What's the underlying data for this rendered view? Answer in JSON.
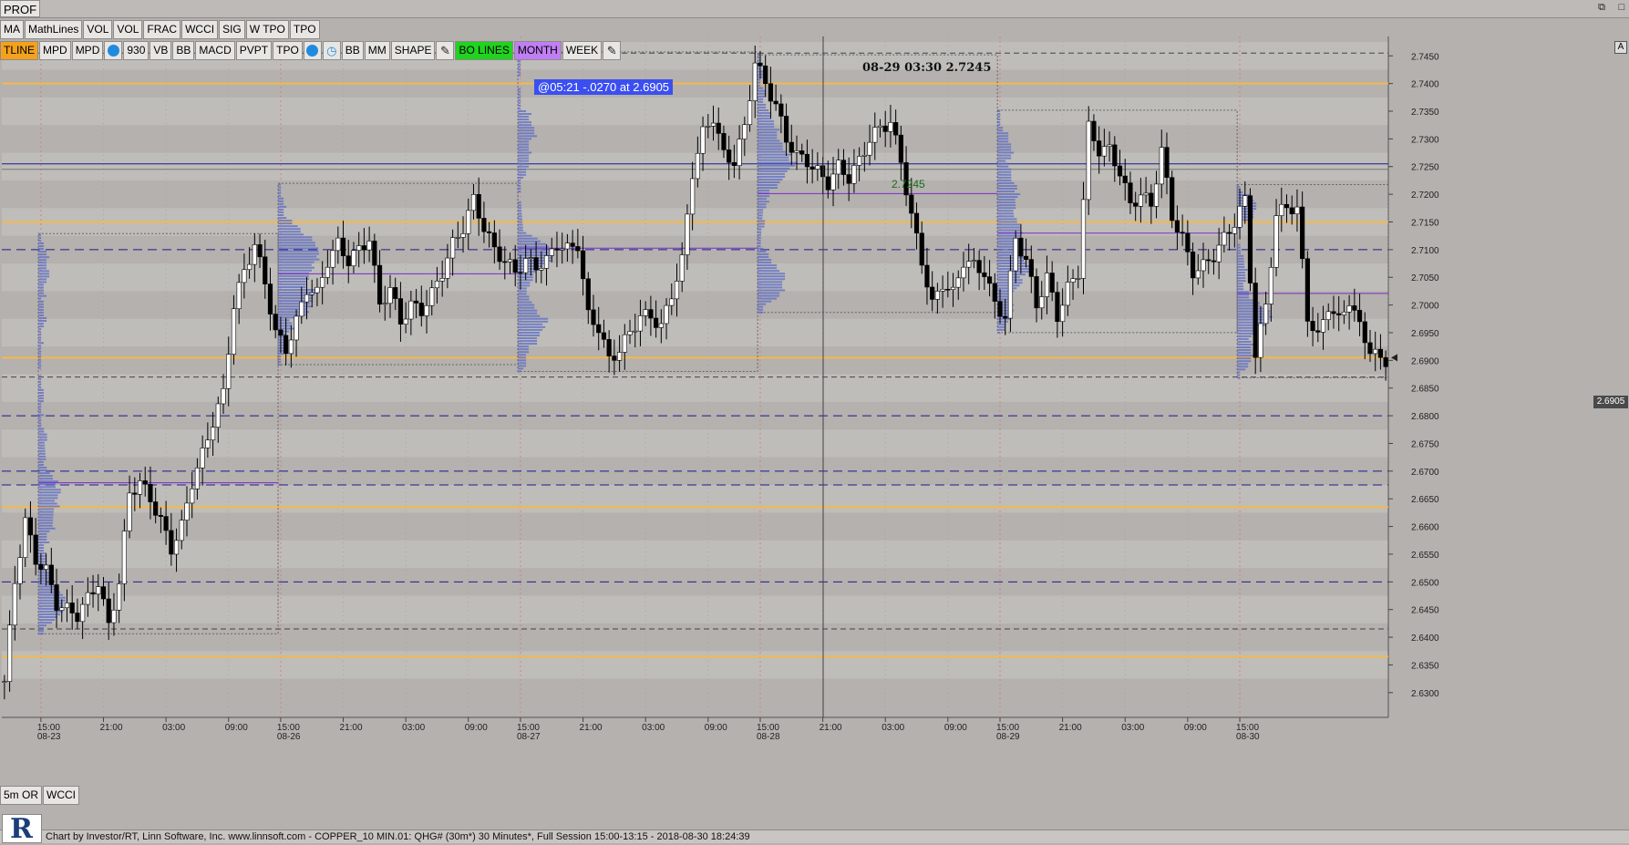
{
  "window": {
    "title": "PROF",
    "controls": [
      "restore-icon",
      "maximize-icon"
    ]
  },
  "toolbar1": [
    "MA",
    "MathLines",
    "VOL",
    "VOL",
    "FRAC",
    "WCCI",
    "SIG",
    "W TPO",
    "TPO"
  ],
  "toolbar2": [
    {
      "label": "TLINE",
      "style": "orange"
    },
    {
      "label": "MPD",
      "style": ""
    },
    {
      "label": "MPD",
      "style": ""
    },
    {
      "label": "",
      "style": "icon",
      "icon": "drop-icon"
    },
    {
      "label": "930",
      "style": ""
    },
    {
      "label": "VB",
      "style": ""
    },
    {
      "label": "BB",
      "style": ""
    },
    {
      "label": "MACD",
      "style": ""
    },
    {
      "label": "PVPT",
      "style": ""
    },
    {
      "label": "TPO",
      "style": ""
    },
    {
      "label": "",
      "style": "icon",
      "icon": "drop-icon"
    },
    {
      "label": "",
      "style": "icon",
      "icon": "clock-icon"
    },
    {
      "label": "BB",
      "style": ""
    },
    {
      "label": "MM",
      "style": ""
    },
    {
      "label": "SHAPE",
      "style": ""
    },
    {
      "label": "",
      "style": "icon",
      "icon": "pencil-icon"
    },
    {
      "label": "BO LINES",
      "style": "green"
    },
    {
      "label": "MONTH",
      "style": "purple"
    },
    {
      "label": "WEEK",
      "style": ""
    },
    {
      "label": "",
      "style": "icon",
      "icon": "pencil-icon"
    }
  ],
  "toolbar3": [
    "5m OR",
    "WCCI"
  ],
  "annotation": "@05:21  -.0270 at 2.6905",
  "crosshair_info": "08-29 03:30  2.7245",
  "poc_marker": "2.7245",
  "last_price": "2.6905",
  "corner_label": "A",
  "status": "Chart by Investor/RT, Linn Software, Inc. www.linnsoft.com - COPPER_10 MIN.01: QHG# (30m*) 30 Minutes*, Full Session 15:00-13:15 - 2018-08-30 18:24:39",
  "colors": {
    "background": "#b4b1ae",
    "band_light": "#c9c6c3",
    "bull": "#ffffff",
    "bear": "#000000",
    "profile": "#5b6cc8",
    "profile_gray": "#707070",
    "orange_line": "#f5b84a",
    "navy_line": "#1b1b8f",
    "purple_line": "#7b2cc8"
  },
  "chart_data": {
    "type": "candlestick",
    "instrument": "QHG#",
    "y_ticks": [
      "2.7450",
      "2.7400",
      "2.7350",
      "2.7300",
      "2.7250",
      "2.7200",
      "2.7150",
      "2.7100",
      "2.7050",
      "2.7000",
      "2.6950",
      "2.6900",
      "2.6850",
      "2.6800",
      "2.6750",
      "2.6700",
      "2.6650",
      "2.6600",
      "2.6550",
      "2.6500",
      "2.6450",
      "2.6400",
      "2.6350",
      "2.6300"
    ],
    "ylim": [
      2.6275,
      2.7485
    ],
    "x_ticks": [
      {
        "t": "15:00",
        "d": "08-23",
        "bar": 7
      },
      {
        "t": "21:00",
        "bar": 19
      },
      {
        "t": "03:00",
        "bar": 31
      },
      {
        "t": "09:00",
        "bar": 43
      },
      {
        "t": "15:00",
        "d": "08-26",
        "bar": 53
      },
      {
        "t": "21:00",
        "bar": 65
      },
      {
        "t": "03:00",
        "bar": 77
      },
      {
        "t": "09:00",
        "bar": 89
      },
      {
        "t": "15:00",
        "d": "08-27",
        "bar": 99
      },
      {
        "t": "21:00",
        "bar": 111
      },
      {
        "t": "03:00",
        "bar": 123
      },
      {
        "t": "09:00",
        "bar": 135
      },
      {
        "t": "15:00",
        "d": "08-28",
        "bar": 145
      },
      {
        "t": "21:00",
        "bar": 157
      },
      {
        "t": "03:00",
        "bar": 169
      },
      {
        "t": "09:00",
        "bar": 181
      },
      {
        "t": "15:00",
        "d": "08-29",
        "bar": 191
      },
      {
        "t": "21:00",
        "bar": 203
      },
      {
        "t": "03:00",
        "bar": 215
      },
      {
        "t": "09:00",
        "bar": 227
      },
      {
        "t": "15:00",
        "d": "08-30",
        "bar": 237
      }
    ],
    "anchors": [
      [
        0,
        2.632
      ],
      [
        2,
        2.65
      ],
      [
        4,
        2.661
      ],
      [
        6,
        2.654
      ],
      [
        8,
        2.652
      ],
      [
        10,
        2.646
      ],
      [
        12,
        2.645
      ],
      [
        14,
        2.644
      ],
      [
        16,
        2.647
      ],
      [
        18,
        2.65
      ],
      [
        20,
        2.642
      ],
      [
        22,
        2.65
      ],
      [
        24,
        2.666
      ],
      [
        26,
        2.668
      ],
      [
        28,
        2.665
      ],
      [
        30,
        2.661
      ],
      [
        32,
        2.656
      ],
      [
        34,
        2.66
      ],
      [
        36,
        2.668
      ],
      [
        38,
        2.673
      ],
      [
        40,
        2.679
      ],
      [
        42,
        2.684
      ],
      [
        44,
        2.7
      ],
      [
        46,
        2.706
      ],
      [
        48,
        2.711
      ],
      [
        50,
        2.704
      ],
      [
        52,
        2.695
      ],
      [
        54,
        2.692
      ],
      [
        56,
        2.697
      ],
      [
        58,
        2.703
      ],
      [
        60,
        2.702
      ],
      [
        62,
        2.708
      ],
      [
        64,
        2.711
      ],
      [
        66,
        2.708
      ],
      [
        68,
        2.71
      ],
      [
        70,
        2.712
      ],
      [
        72,
        2.7
      ],
      [
        74,
        2.703
      ],
      [
        76,
        2.697
      ],
      [
        78,
        2.7
      ],
      [
        80,
        2.699
      ],
      [
        82,
        2.702
      ],
      [
        84,
        2.706
      ],
      [
        86,
        2.711
      ],
      [
        88,
        2.714
      ],
      [
        90,
        2.719
      ],
      [
        92,
        2.714
      ],
      [
        94,
        2.71
      ],
      [
        96,
        2.708
      ],
      [
        98,
        2.706
      ],
      [
        100,
        2.708
      ],
      [
        102,
        2.707
      ],
      [
        104,
        2.708
      ],
      [
        106,
        2.711
      ],
      [
        108,
        2.71
      ],
      [
        110,
        2.711
      ],
      [
        112,
        2.698
      ],
      [
        114,
        2.696
      ],
      [
        116,
        2.69
      ],
      [
        118,
        2.692
      ],
      [
        120,
        2.695
      ],
      [
        122,
        2.698
      ],
      [
        124,
        2.698
      ],
      [
        126,
        2.696
      ],
      [
        128,
        2.702
      ],
      [
        130,
        2.708
      ],
      [
        132,
        2.724
      ],
      [
        134,
        2.731
      ],
      [
        136,
        2.734
      ],
      [
        138,
        2.727
      ],
      [
        140,
        2.726
      ],
      [
        142,
        2.732
      ],
      [
        144,
        2.744
      ],
      [
        146,
        2.74
      ],
      [
        148,
        2.736
      ],
      [
        150,
        2.73
      ],
      [
        152,
        2.727
      ],
      [
        154,
        2.726
      ],
      [
        156,
        2.724
      ],
      [
        158,
        2.722
      ],
      [
        160,
        2.725
      ],
      [
        162,
        2.723
      ],
      [
        164,
        2.726
      ],
      [
        166,
        2.73
      ],
      [
        168,
        2.732
      ],
      [
        170,
        2.733
      ],
      [
        172,
        2.726
      ],
      [
        174,
        2.716
      ],
      [
        176,
        2.708
      ],
      [
        178,
        2.7
      ],
      [
        180,
        2.704
      ],
      [
        182,
        2.702
      ],
      [
        184,
        2.708
      ],
      [
        186,
        2.707
      ],
      [
        188,
        2.706
      ],
      [
        190,
        2.7
      ],
      [
        192,
        2.698
      ],
      [
        194,
        2.712
      ],
      [
        196,
        2.708
      ],
      [
        198,
        2.7
      ],
      [
        200,
        2.705
      ],
      [
        202,
        2.698
      ],
      [
        204,
        2.703
      ],
      [
        206,
        2.706
      ],
      [
        208,
        2.732
      ],
      [
        210,
        2.728
      ],
      [
        212,
        2.728
      ],
      [
        214,
        2.724
      ],
      [
        216,
        2.718
      ],
      [
        218,
        2.72
      ],
      [
        220,
        2.718
      ],
      [
        222,
        2.728
      ],
      [
        224,
        2.716
      ],
      [
        226,
        2.712
      ],
      [
        228,
        2.706
      ],
      [
        230,
        2.707
      ],
      [
        232,
        2.709
      ],
      [
        234,
        2.712
      ],
      [
        236,
        2.715
      ],
      [
        238,
        2.719
      ],
      [
        240,
        2.691
      ],
      [
        242,
        2.7
      ],
      [
        244,
        2.716
      ],
      [
        246,
        2.718
      ],
      [
        248,
        2.717
      ],
      [
        250,
        2.698
      ],
      [
        252,
        2.694
      ],
      [
        254,
        2.7
      ],
      [
        256,
        2.697
      ],
      [
        258,
        2.701
      ],
      [
        260,
        2.696
      ],
      [
        262,
        2.692
      ],
      [
        264,
        2.69
      ]
    ],
    "h_lines": [
      {
        "y": 2.7255,
        "kind": "solid_navy"
      },
      {
        "y": 2.7245,
        "kind": "solid_gray"
      },
      {
        "y": 2.6905,
        "kind": "solid_orange"
      },
      {
        "y": 2.74,
        "kind": "solid_orange"
      },
      {
        "y": 2.71,
        "kind": "dash_navy"
      },
      {
        "y": 2.68,
        "kind": "dash_navy"
      },
      {
        "y": 2.6675,
        "kind": "dash_navy"
      },
      {
        "y": 2.65,
        "kind": "dash_navy"
      },
      {
        "y": 2.67,
        "kind": "dash_navy"
      },
      {
        "y": 2.6365,
        "kind": "solid_orange"
      },
      {
        "y": 2.6635,
        "kind": "solid_orange"
      },
      {
        "y": 2.715,
        "kind": "solid_orange"
      },
      {
        "y": 2.6415,
        "kind": "dash_dark"
      },
      {
        "y": 2.7455,
        "kind": "dash_dark"
      },
      {
        "y": 2.687,
        "kind": "dash_dark"
      }
    ],
    "grid": true,
    "legend": "none"
  }
}
